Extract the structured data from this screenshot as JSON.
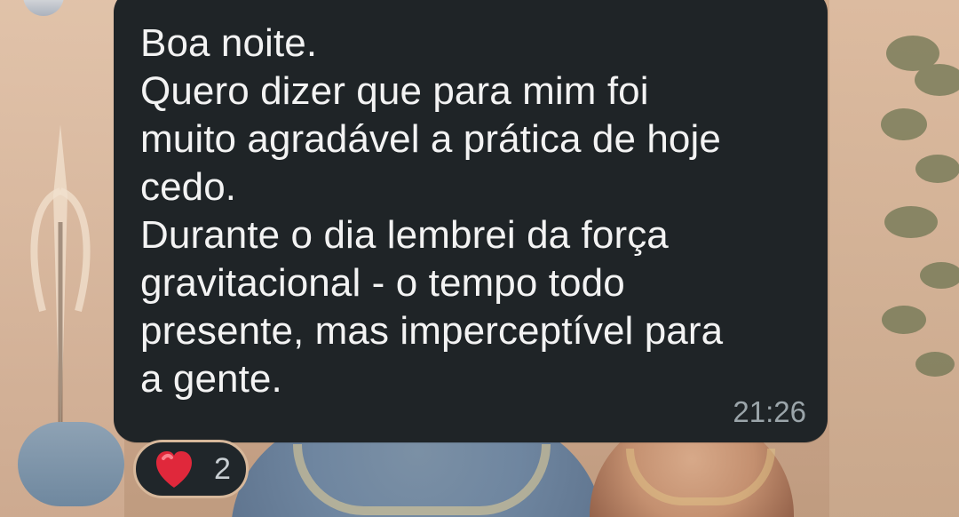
{
  "message": {
    "lines": [
      "Boa noite.",
      "Quero dizer que para mim foi",
      "muito agradável a prática de hoje",
      "cedo.",
      "Durante o dia lembrei da força",
      "gravitacional - o tempo todo",
      "presente, mas imperceptível para",
      "a gente."
    ],
    "time": "21:26"
  },
  "reaction": {
    "emoji": "red-heart",
    "count": "2"
  },
  "colors": {
    "bubble": "#1f2427",
    "text": "#f3f3f3",
    "time": "#9ba5aa",
    "reaction_bg": "#20262a",
    "heart": "#e0283b"
  }
}
